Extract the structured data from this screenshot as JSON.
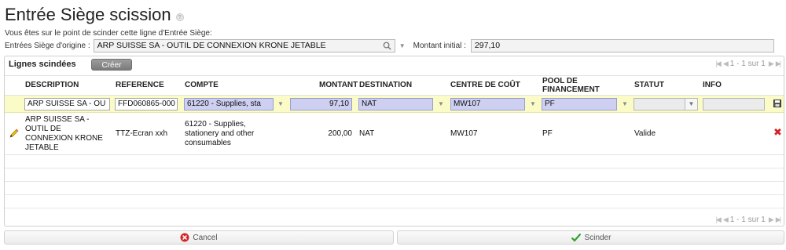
{
  "page": {
    "title": "Entrée Siège scission",
    "intro": "Vous êtes sur le point de scinder cette ligne d'Entrée Siège:"
  },
  "origin": {
    "label": "Entrées Siège d'origine :",
    "value": "ARP SUISSE SA - OUTIL DE CONNEXION KRONE JETABLE",
    "montant_label": "Montant initial :",
    "montant_value": "297,10"
  },
  "panel": {
    "title": "Lignes scindées",
    "create_label": "Créer",
    "pager_text": "1 - 1 sur 1",
    "columns": {
      "description": "DESCRIPTION",
      "reference": "REFERENCE",
      "compte": "COMPTE",
      "montant": "MONTANT",
      "destination": "DESTINATION",
      "centre": "CENTRE DE COÛT",
      "pool_line1": "POOL DE",
      "pool_line2": "FINANCEMENT",
      "statut": "STATUT",
      "info": "INFO"
    },
    "edit_row": {
      "description": "ARP SUISSE SA - OU",
      "reference": "FFD060865-000",
      "compte": "61220 - Supplies, sta",
      "montant": "97,10",
      "destination": "NAT",
      "centre": "MW107",
      "pool": "PF",
      "statut": "",
      "info": ""
    },
    "rows": [
      {
        "description_lines": [
          "ARP SUISSE SA -",
          "OUTIL DE",
          "CONNEXION KRONE",
          "JETABLE"
        ],
        "reference": "TTZ-Ecran xxh",
        "compte_lines": [
          "61220 - Supplies,",
          "stationery and other",
          "consumables"
        ],
        "montant": "200,00",
        "destination": "NAT",
        "centre": "MW107",
        "pool": "PF",
        "statut": "Valide"
      }
    ]
  },
  "actions": {
    "cancel_label": "Cancel",
    "scinder_label": "Scinder"
  },
  "colors": {
    "edit_row_bg": "#fbfbc8",
    "required_field_bg": "#ced0f2",
    "delete_red": "#d42424",
    "ok_green": "#2fa22f"
  }
}
